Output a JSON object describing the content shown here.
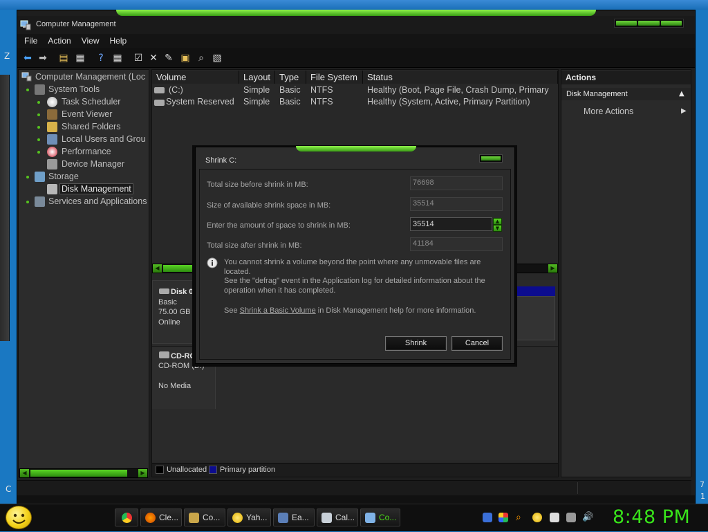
{
  "window": {
    "title": "Computer Management",
    "menu": [
      "File",
      "Action",
      "View",
      "Help"
    ]
  },
  "tree": {
    "root": "Computer Management (Loc",
    "system_tools": "System Tools",
    "task_scheduler": "Task Scheduler",
    "event_viewer": "Event Viewer",
    "shared_folders": "Shared Folders",
    "local_users": "Local Users and Grou",
    "performance": "Performance",
    "device_manager": "Device Manager",
    "storage": "Storage",
    "disk_management": "Disk Management",
    "services": "Services and Applications"
  },
  "volumes": {
    "headers": [
      "Volume",
      "Layout",
      "Type",
      "File System",
      "Status"
    ],
    "rows": [
      {
        "volume": "(C:)",
        "layout": "Simple",
        "type": "Basic",
        "fs": "NTFS",
        "status": "Healthy (Boot, Page File, Crash Dump, Primary"
      },
      {
        "volume": "System Reserved",
        "layout": "Simple",
        "type": "Basic",
        "fs": "NTFS",
        "status": "Healthy (System, Active, Primary Partition)"
      }
    ]
  },
  "disks": {
    "disk0_name": "Disk 0",
    "disk0_type": "Basic",
    "disk0_size": "75.00 GB",
    "disk0_state": "Online",
    "cdrom_name": "CD-RO",
    "cdrom_type": "CD-ROM (D:)",
    "cdrom_state": "No Media"
  },
  "legend": {
    "unallocated": "Unallocated",
    "primary": "Primary partition"
  },
  "actions": {
    "header": "Actions",
    "section": "Disk Management",
    "more": "More Actions"
  },
  "dialog": {
    "title": "Shrink C:",
    "total_before_label": "Total size before shrink in MB:",
    "total_before_value": "76698",
    "available_label": "Size of available shrink space in MB:",
    "available_value": "35514",
    "amount_label": "Enter the amount of space to shrink in MB:",
    "amount_value": "35514",
    "total_after_label": "Total size after shrink in MB:",
    "total_after_value": "41184",
    "info_line1": "You cannot shrink a volume beyond the point where any unmovable files are located.",
    "info_line2": "See the \"defrag\" event in the Application log for detailed information about the",
    "info_line3": "operation when it has completed.",
    "see_prefix": "See",
    "see_link": "Shrink a Basic Volume",
    "see_suffix": "in Disk Management help for more information.",
    "shrink_btn": "Shrink",
    "cancel_btn": "Cancel"
  },
  "taskbar": {
    "tasks": [
      "Cle...",
      "Co...",
      "Yah...",
      "Ea...",
      "Cal...",
      "Co..."
    ],
    "clock": "8:48 PM"
  },
  "desktop": {
    "edge_z": "Z",
    "edge_c": "C",
    "edge_7": "7",
    "edge_1": "1"
  }
}
